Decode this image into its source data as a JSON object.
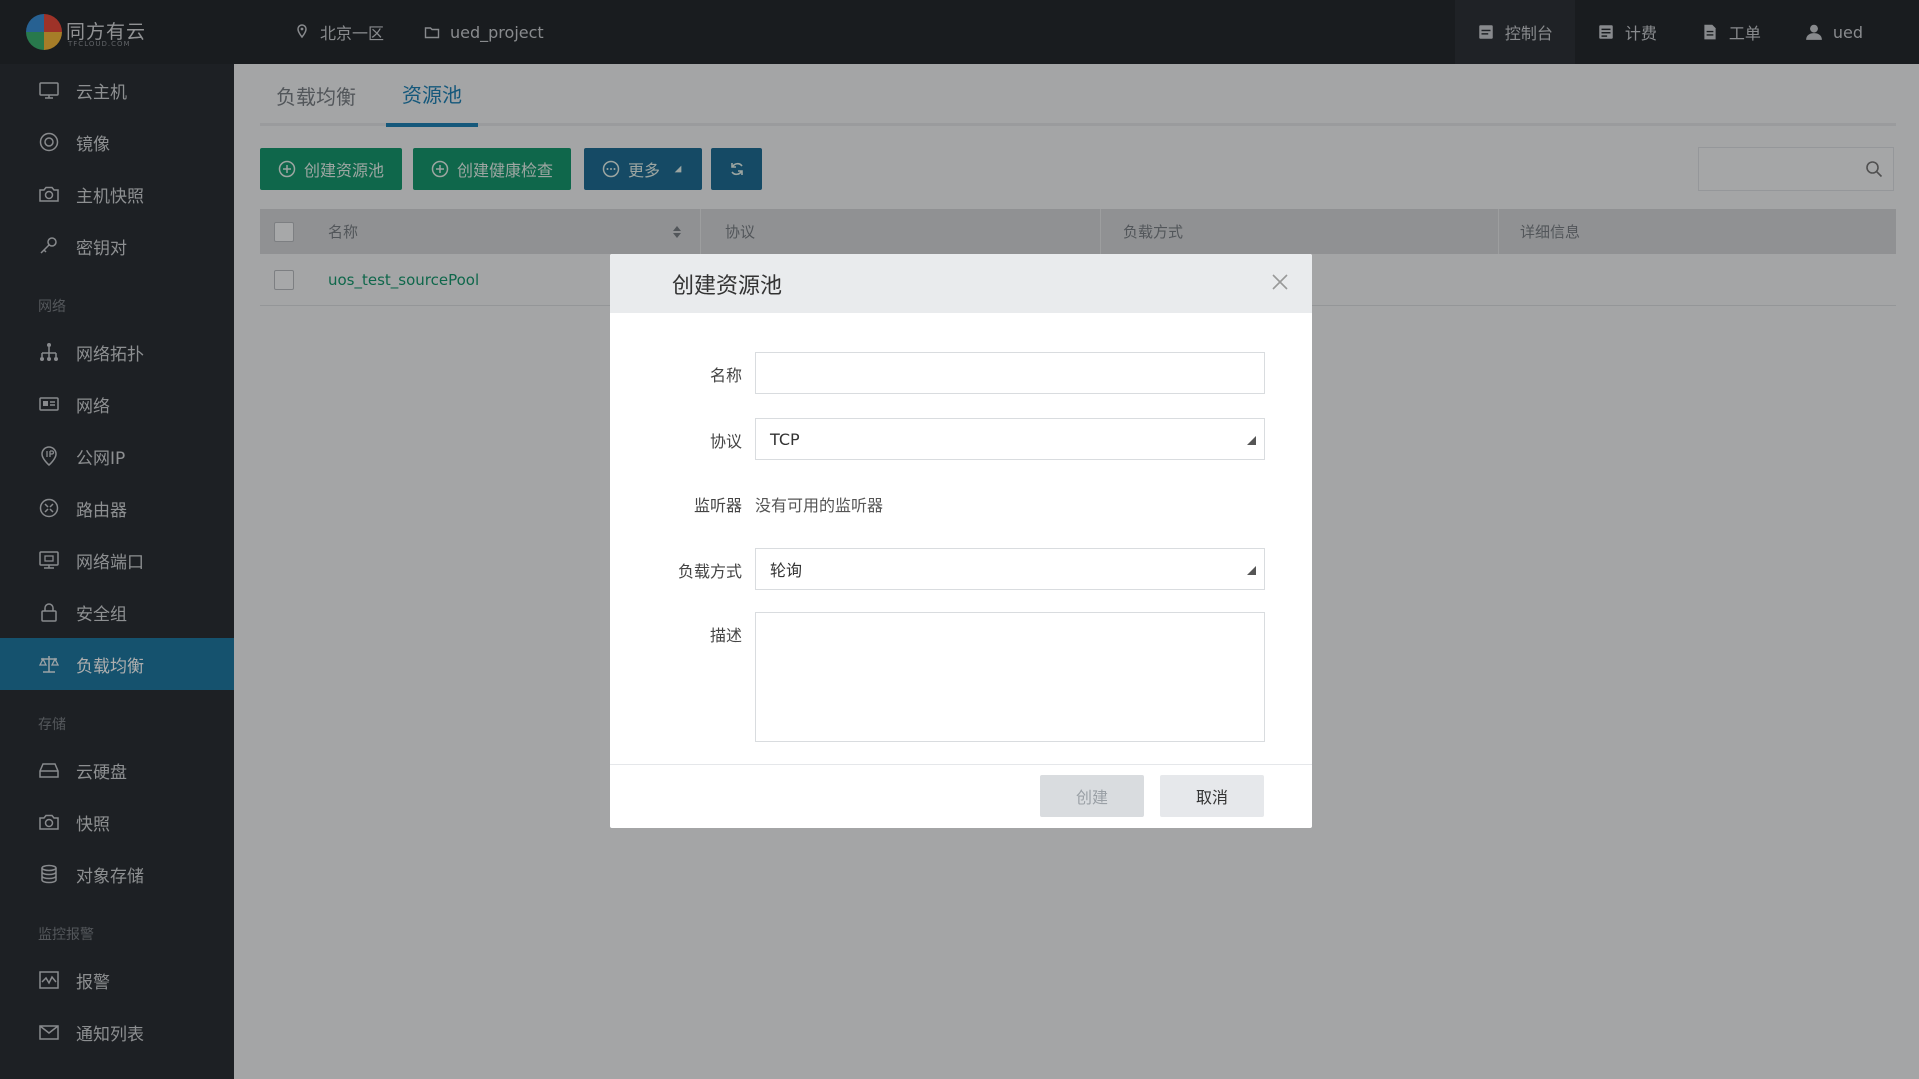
{
  "topbar": {
    "brand": "同方有云",
    "brand_sub": "TFCLOUD.COM",
    "region": "北京一区",
    "project": "ued_project",
    "right_items": [
      {
        "label": "控制台",
        "icon": "console-icon"
      },
      {
        "label": "计费",
        "icon": "billing-icon"
      },
      {
        "label": "工单",
        "icon": "ticket-icon"
      },
      {
        "label": "ued",
        "icon": "user-icon"
      }
    ]
  },
  "sidebar": {
    "items": [
      {
        "label": "云主机",
        "icon": "monitor-icon"
      },
      {
        "label": "镜像",
        "icon": "disc-icon"
      },
      {
        "label": "主机快照",
        "icon": "camera-icon"
      },
      {
        "label": "密钥对",
        "icon": "key-icon"
      }
    ],
    "section_network": "网络",
    "network_items": [
      {
        "label": "网络拓扑",
        "icon": "topology-icon"
      },
      {
        "label": "网络",
        "icon": "network-icon"
      },
      {
        "label": "公网IP",
        "icon": "ip-icon"
      },
      {
        "label": "路由器",
        "icon": "router-icon"
      },
      {
        "label": "网络端口",
        "icon": "port-icon"
      },
      {
        "label": "安全组",
        "icon": "lock-icon"
      },
      {
        "label": "负载均衡",
        "icon": "balance-icon"
      }
    ],
    "section_storage": "存储",
    "storage_items": [
      {
        "label": "云硬盘",
        "icon": "harddisk-icon"
      },
      {
        "label": "快照",
        "icon": "camera-icon"
      },
      {
        "label": "对象存储",
        "icon": "database-icon"
      }
    ],
    "section_monitor": "监控报警",
    "monitor_items": [
      {
        "label": "报警",
        "icon": "chart-icon"
      },
      {
        "label": "通知列表",
        "icon": "mail-icon"
      }
    ]
  },
  "main": {
    "tabs": [
      {
        "label": "负载均衡"
      },
      {
        "label": "资源池"
      }
    ],
    "toolbar": {
      "create_pool": "创建资源池",
      "create_health_check": "创建健康检查",
      "more": "更多"
    },
    "table": {
      "headers": [
        "名称",
        "协议",
        "负载方式",
        "详细信息"
      ],
      "rows": [
        {
          "name": "uos_test_sourcePool"
        }
      ]
    }
  },
  "modal": {
    "title": "创建资源池",
    "name_label": "名称",
    "name_value": "",
    "protocol_label": "协议",
    "protocol_value": "TCP",
    "listener_label": "监听器",
    "listener_value": "没有可用的监听器",
    "method_label": "负载方式",
    "method_value": "轮询",
    "desc_label": "描述",
    "create_button": "创建",
    "cancel_button": "取消"
  }
}
